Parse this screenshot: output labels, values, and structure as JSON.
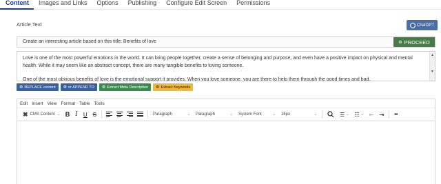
{
  "tabs": [
    "Content",
    "Images and Links",
    "Options",
    "Publishing",
    "Configure Edit Screen",
    "Permissions"
  ],
  "section_label": "Article Text",
  "chatgpt_button": "ChatGPT",
  "prompt_text": "Create an interesting article based on this title:  Benefits of love",
  "proceed_button": "PROCEED",
  "article_paragraphs": [
    "Love is one of the most powerful emotions in the world. It can bring people together, create a sense of belonging and purpose, and even have a positive impact on physical and mental health. While it may seem like an abstract concept, there are many tangible benefits to loving someone.",
    "One of the most obvious benefits of love is the emotional support it provides. When you love someone, you are there to help them through the good times and bad."
  ],
  "actions": [
    "REPLACE content",
    "or APPEND TO",
    "Extract Meta Description",
    "Extract Keywords"
  ],
  "menubar": [
    "Edit",
    "Insert",
    "View",
    "Format",
    "Table",
    "Tools"
  ],
  "toolbar": {
    "cms_content": "CMS Content",
    "bold": "B",
    "italic": "I",
    "underline": "U",
    "strike": "S",
    "block_format": "Paragraph",
    "paragraph": "Paragraph",
    "font_family": "System Font",
    "font_size": "16px",
    "more": "•••"
  },
  "colors": {
    "active_tab": "#1e3a8a",
    "chatgpt": "#4a6fa5",
    "proceed": "#4a7a4a",
    "blue_btn": "#3a5f9e",
    "green_btn": "#3d8a4f",
    "yellow_btn": "#f0b73a"
  }
}
